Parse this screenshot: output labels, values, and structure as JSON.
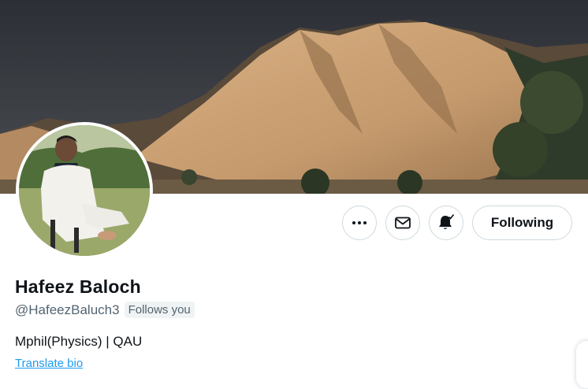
{
  "profile": {
    "name": "Hafeez Baloch",
    "handle": "@HafeezBaluch3",
    "follows_you_label": "Follows you",
    "bio": "Mphil(Physics) | QAU",
    "translate_label": "Translate bio"
  },
  "actions": {
    "more_icon": "more-icon",
    "message_icon": "mail-icon",
    "notifications_icon": "bell-subscribed-icon",
    "following_label": "Following"
  },
  "colors": {
    "link": "#1d9bf0",
    "secondary_text": "#536471",
    "border": "#cfd9de"
  }
}
